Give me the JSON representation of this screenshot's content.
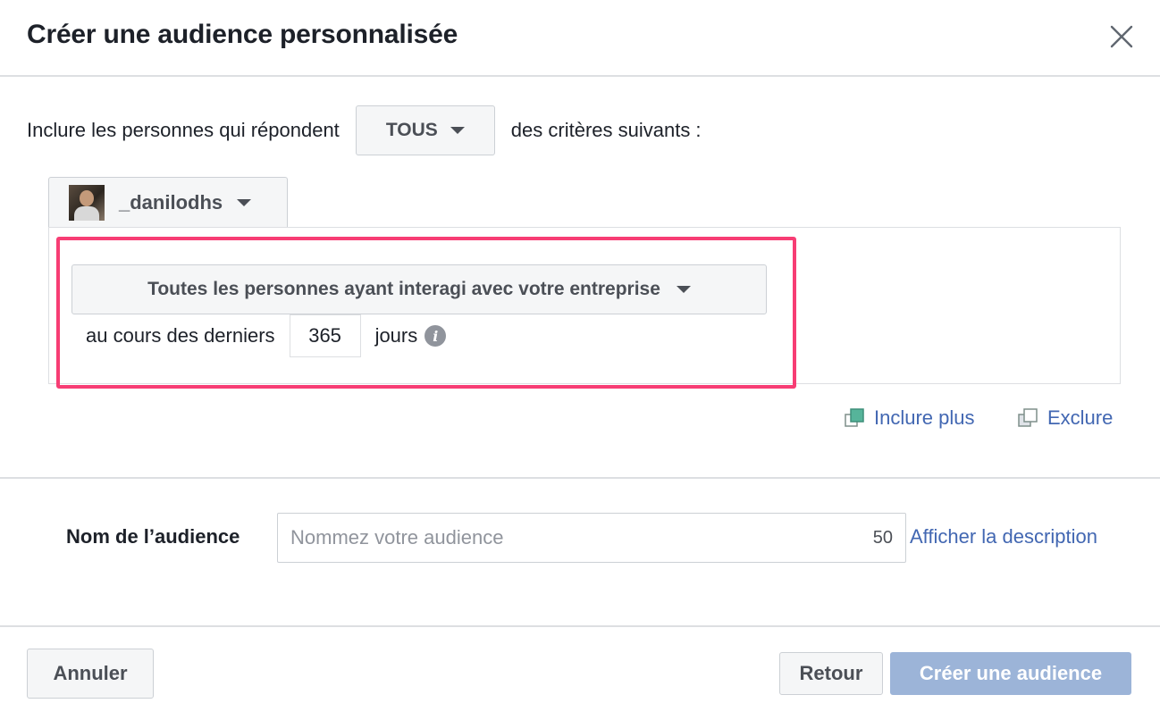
{
  "dialog": {
    "title": "Créer une audience personnalisée"
  },
  "criteria": {
    "prefix": "Inclure les personnes qui répondent",
    "match_value": "TOUS",
    "suffix": "des critères suivants :"
  },
  "source": {
    "account_name": "_danilodhs"
  },
  "rule": {
    "engagement_option": "Toutes les personnes ayant interagi avec votre entreprise",
    "period_prefix": "au cours des derniers",
    "days_value": "365",
    "period_suffix": "jours"
  },
  "actions": {
    "include_more": "Inclure plus",
    "exclude": "Exclure"
  },
  "audience_name": {
    "label": "Nom de l’audience",
    "placeholder": "Nommez votre audience",
    "char_limit": "50",
    "show_description": "Afficher la description"
  },
  "footer": {
    "cancel": "Annuler",
    "back": "Retour",
    "create": "Créer une audience"
  },
  "colors": {
    "highlight": "#f73d74",
    "link": "#4267b2",
    "primary_disabled": "#9cb4d8"
  },
  "icons": [
    "close-icon",
    "caret-down-icon",
    "info-icon",
    "include-more-icon",
    "exclude-icon"
  ]
}
